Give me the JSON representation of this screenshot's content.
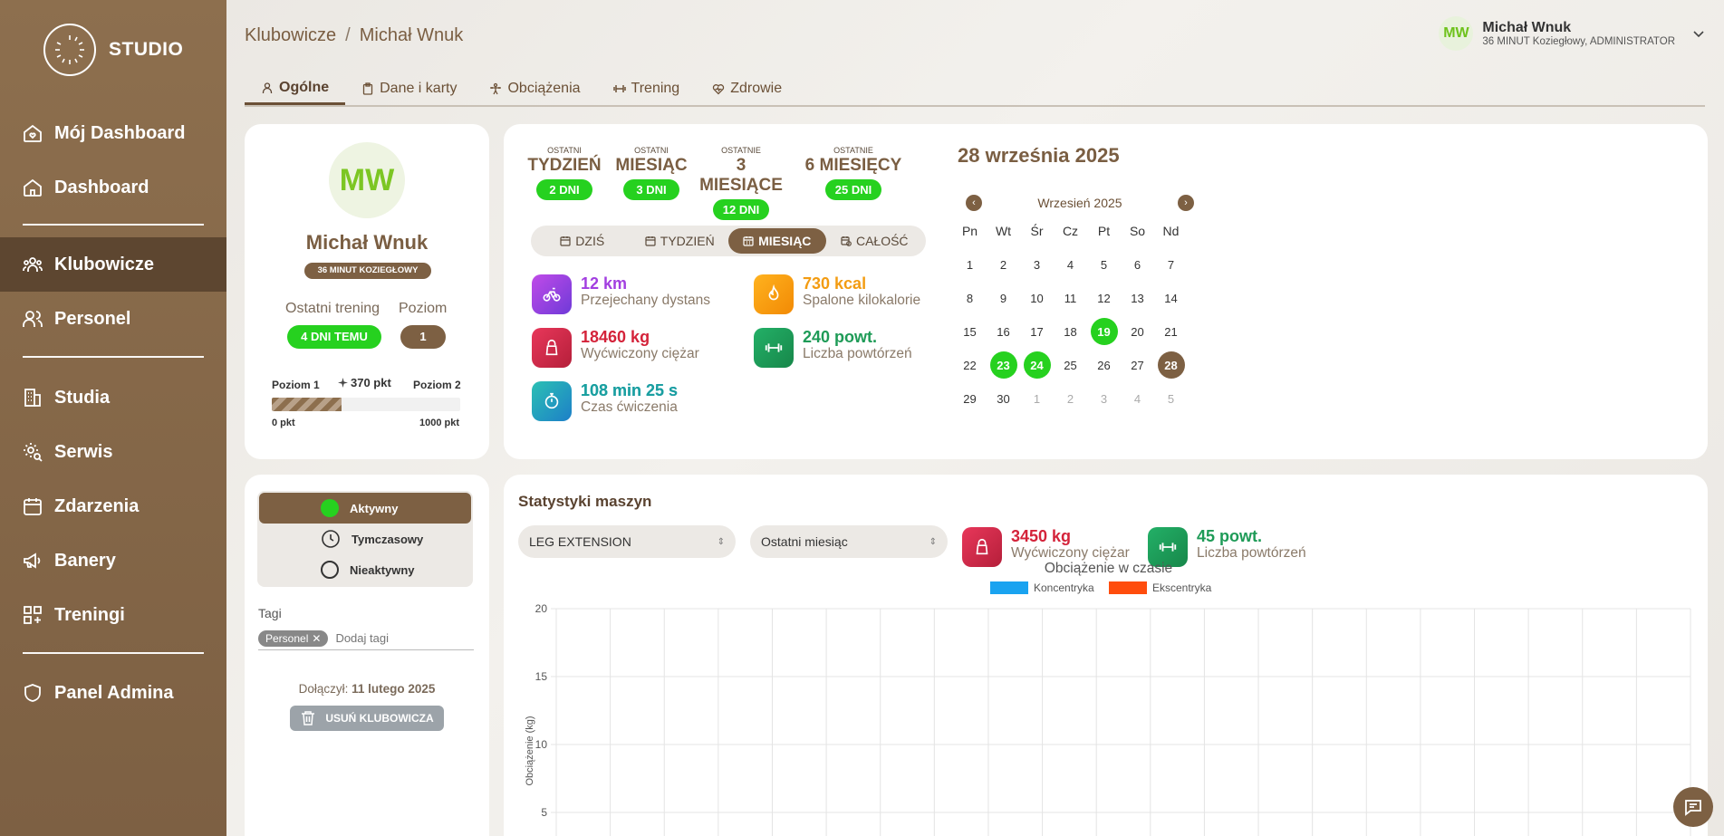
{
  "sidebar": {
    "logo_text": "STUDIO",
    "items": [
      {
        "label": "Mój Dashboard",
        "icon": "home-heart-icon"
      },
      {
        "label": "Dashboard",
        "icon": "home-icon"
      },
      {
        "label": "Klubowicze",
        "icon": "users-icon"
      },
      {
        "label": "Personel",
        "icon": "user-group-icon"
      },
      {
        "label": "Studia",
        "icon": "building-icon"
      },
      {
        "label": "Serwis",
        "icon": "settings-search-icon"
      },
      {
        "label": "Zdarzenia",
        "icon": "calendar-icon"
      },
      {
        "label": "Banery",
        "icon": "megaphone-icon"
      },
      {
        "label": "Treningi",
        "icon": "grid-plus-icon"
      },
      {
        "label": "Panel Admina",
        "icon": "shield-icon"
      }
    ]
  },
  "header": {
    "breadcrumb": [
      "Klubowicze",
      "Michał Wnuk"
    ],
    "user": {
      "initials": "MW",
      "name": "Michał Wnuk",
      "role": "36 MINUT Koziegłowy, ADMINISTRATOR"
    }
  },
  "tabs": [
    "Ogólne",
    "Dane i karty",
    "Obciążenia",
    "Trening",
    "Zdrowie"
  ],
  "profile": {
    "initials": "MW",
    "name": "Michał Wnuk",
    "club": "36 MINUT KOZIEGŁOWY",
    "last_training_label": "Ostatni trening",
    "last_training_value": "4 DNI TEMU",
    "level_label": "Poziom",
    "level_value": "1",
    "level_from": "Poziom 1",
    "level_to": "Poziom 2",
    "points": "370 pkt",
    "min": "0 pkt",
    "max": "1000 pkt",
    "progress_fraction": 0.37
  },
  "periods": [
    {
      "over": "OSTATNI",
      "title": "TYDZIEŃ",
      "value": "2 DNI"
    },
    {
      "over": "OSTATNI",
      "title": "MIESIĄC",
      "value": "3 DNI"
    },
    {
      "over": "OSTATNIE",
      "title": "3 MIESIĄCE",
      "value": "12 DNI"
    },
    {
      "over": "OSTATNIE",
      "title": "6 MIESIĘCY",
      "value": "25 DNI"
    }
  ],
  "range_tabs": [
    "DZIŚ",
    "TYDZIEŃ",
    "MIESIĄC",
    "CAŁOŚĆ"
  ],
  "stats": [
    {
      "value": "12 km",
      "label": "Przejechany dystans",
      "color": "#a23fe0"
    },
    {
      "value": "730 kcal",
      "label": "Spalone kilokalorie",
      "color": "#f39c12"
    },
    {
      "value": "18460 kg",
      "label": "Wyćwiczony ciężar",
      "color": "#d4233a"
    },
    {
      "value": "240 powt.",
      "label": "Liczba powtórzeń",
      "color": "#1e9b57"
    },
    {
      "value": "108 min 25 s",
      "label": "Czas ćwiczenia",
      "color": "#1aa0a0"
    }
  ],
  "calendar": {
    "title": "28 września 2025",
    "month": "Wrzesień 2025",
    "dow": [
      "Pn",
      "Wt",
      "Śr",
      "Cz",
      "Pt",
      "So",
      "Nd"
    ],
    "days": [
      "1",
      "2",
      "3",
      "4",
      "5",
      "6",
      "7",
      "8",
      "9",
      "10",
      "11",
      "12",
      "13",
      "14",
      "15",
      "16",
      "17",
      "18",
      "19",
      "20",
      "21",
      "22",
      "23",
      "24",
      "25",
      "26",
      "27",
      "28",
      "29",
      "30",
      "1",
      "2",
      "3",
      "4",
      "5"
    ]
  },
  "status": {
    "options": [
      "Aktywny",
      "Tymczasowy",
      "Nieaktywny"
    ],
    "tags_label": "Tagi",
    "tag": "Personel",
    "tag_placeholder": "Dodaj tagi",
    "joined_label": "Dołączył:",
    "joined_date": "11 lutego 2025",
    "delete_label": "USUŃ KLUBOWICZA"
  },
  "machine": {
    "title": "Statystyki maszyn",
    "machine_select": "LEG EXTENSION",
    "period_select": "Ostatni miesiąc",
    "weight_value": "3450 kg",
    "weight_label": "Wyćwiczony ciężar",
    "reps_value": "45 powt.",
    "reps_label": "Liczba powtórzeń"
  },
  "chart_data": {
    "type": "bar",
    "title": "Obciążenie w czasie",
    "ylabel": "Obciążenie (kg)",
    "xlabel": "",
    "ylim": [
      0,
      20
    ],
    "y_ticks": [
      "20",
      "15",
      "10",
      "5"
    ],
    "series": [
      {
        "name": "Koncentryka",
        "color": "#1aa3f0",
        "values": []
      },
      {
        "name": "Ekscentryka",
        "color": "#ff4d0d",
        "values": []
      }
    ],
    "grid": true,
    "legend": "top-center"
  }
}
